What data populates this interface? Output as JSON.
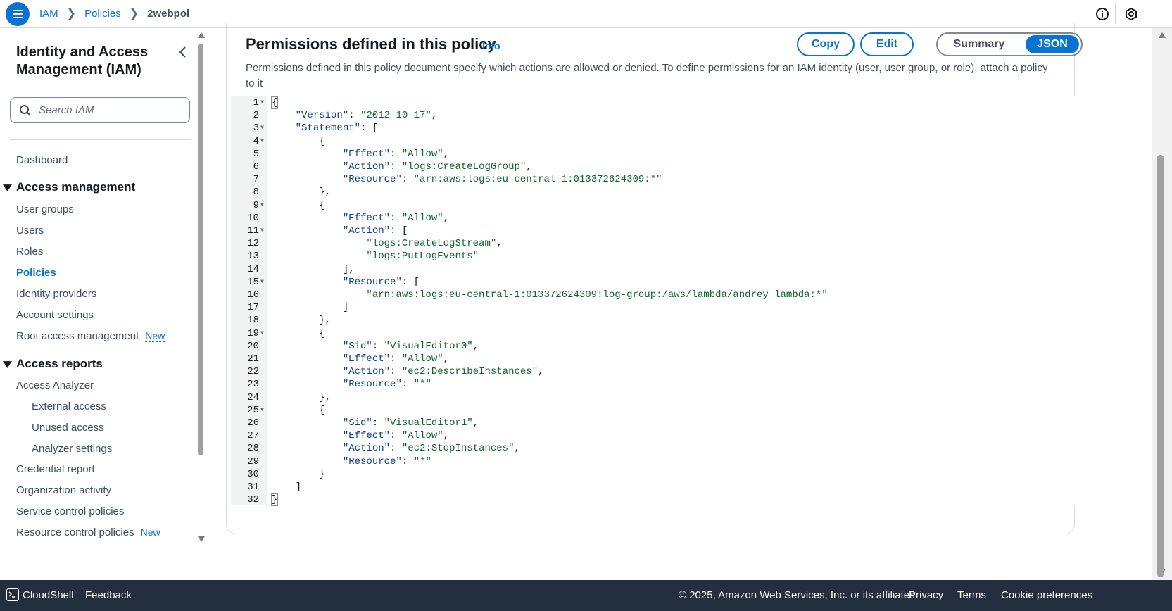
{
  "breadcrumb": {
    "items": [
      "IAM",
      "Policies"
    ],
    "current": "2webpol"
  },
  "sidebar": {
    "title": "Identity and Access Management (IAM)",
    "search_placeholder": "Search IAM",
    "dashboard": "Dashboard",
    "access_management": {
      "label": "Access management",
      "items": [
        "User groups",
        "Users",
        "Roles",
        "Policies",
        "Identity providers",
        "Account settings",
        "Root access management"
      ],
      "active": "Policies"
    },
    "access_reports": {
      "label": "Access reports",
      "analyzer": "Access Analyzer",
      "analyzer_items": [
        "External access",
        "Unused access",
        "Analyzer settings"
      ],
      "items": [
        "Credential report",
        "Organization activity",
        "Service control policies",
        "Resource control policies"
      ]
    },
    "new_badge": "New"
  },
  "panel": {
    "title": "Permissions defined in this policy",
    "info": "Info",
    "description": "Permissions defined in this policy document specify which actions are allowed or denied. To define permissions for an IAM identity (user, user group, or role), attach a policy to it",
    "copy_label": "Copy",
    "edit_label": "Edit",
    "view_summary": "Summary",
    "view_json": "JSON",
    "selected_view": "JSON"
  },
  "code_lines": [
    "{",
    "    \"Version\": \"2012-10-17\",",
    "    \"Statement\": [",
    "        {",
    "            \"Effect\": \"Allow\",",
    "            \"Action\": \"logs:CreateLogGroup\",",
    "            \"Resource\": \"arn:aws:logs:eu-central-1:013372624309:*\"",
    "        },",
    "        {",
    "            \"Effect\": \"Allow\",",
    "            \"Action\": [",
    "                \"logs:CreateLogStream\",",
    "                \"logs:PutLogEvents\"",
    "            ],",
    "            \"Resource\": [",
    "                \"arn:aws:logs:eu-central-1:013372624309:log-group:/aws/lambda/andrey_lambda:*\"",
    "            ]",
    "        },",
    "        {",
    "            \"Sid\": \"VisualEditor0\",",
    "            \"Effect\": \"Allow\",",
    "            \"Action\": \"ec2:DescribeInstances\",",
    "            \"Resource\": \"*\"",
    "        },",
    "        {",
    "            \"Sid\": \"VisualEditor1\",",
    "            \"Effect\": \"Allow\",",
    "            \"Action\": \"ec2:StopInstances\",",
    "            \"Resource\": \"*\"",
    "        }",
    "    ]",
    "}"
  ],
  "fold_lines": [
    1,
    3,
    4,
    9,
    11,
    15,
    19,
    25
  ],
  "footer": {
    "cloudshell": "CloudShell",
    "feedback": "Feedback",
    "copyright": "© 2025, Amazon Web Services, Inc. or its affiliates.",
    "privacy": "Privacy",
    "terms": "Terms",
    "cookies": "Cookie preferences"
  },
  "colors": {
    "accent": "#0972d3",
    "footer_bg": "#232f3e",
    "json_key": "#0f3f8a",
    "json_string": "#116329"
  }
}
